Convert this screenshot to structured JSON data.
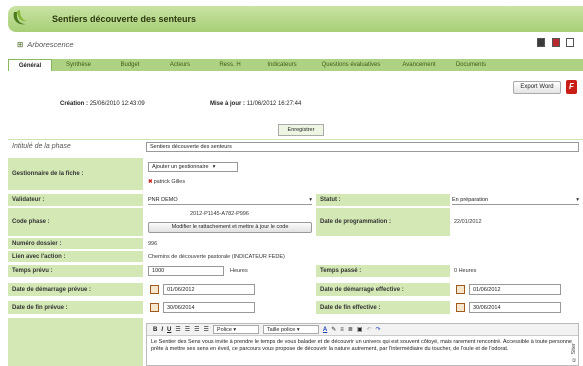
{
  "app": {
    "title": "Sentiers découverte des senteurs"
  },
  "tree": {
    "label": "Arborescence"
  },
  "tabs": [
    "Général",
    "Synthèse",
    "Budget",
    "Acteurs",
    "Ress. H",
    "Indicateurs",
    "Questions évaluatives",
    "Avancement",
    "Documents"
  ],
  "actions": {
    "export_label": "Export Word",
    "pdf_glyph": "F"
  },
  "meta": {
    "creation_label": "Création :",
    "creation_value": "25/06/2010 12:43:09",
    "update_label": "Mise à jour :",
    "update_value": "11/06/2012 16:27:44"
  },
  "save_label": "Enregistrer",
  "form": {
    "phase_label": "Intitulé de la phase",
    "phase_value": "Sentiers découverte des senteurs",
    "gestionnaire_label": "Gestionnaire de la fiche :",
    "gestionnaire_select": "Ajouter un gestionnaire",
    "gestionnaire_user": "patrick Gilles",
    "validateur_label": "Validateur :",
    "validateur_value": "PNR DEMO",
    "statut_label": "Statut :",
    "statut_value": "En préparation",
    "code_label": "Code phase :",
    "code_value": "2012-P1145-A782-P996",
    "code_button": "Modifier le rattachement et mettre à jour le code",
    "prog_label": "Date de programmation :",
    "prog_value": "22/01/2012",
    "dossier_label": "Numéro dossier :",
    "dossier_value": "996",
    "lien_label": "Lien avec l'action :",
    "lien_value": "Chemins de découverte pastorale (INDICATEUR FEDE)",
    "temps_prevu_label": "Temps prévu :",
    "temps_prevu_value": "1000",
    "temps_prevu_unit": "Heures",
    "temps_passe_label": "Temps passé :",
    "temps_passe_value": "0 Heures",
    "dem_prevue_label": "Date de démarrage prévue :",
    "dem_prevue_value": "01/06/2012",
    "dem_eff_label": "Date de démarrage effective :",
    "dem_eff_value": "01/06/2012",
    "fin_prevue_label": "Date de fin prévue :",
    "fin_prevue_value": "30/06/2014",
    "fin_eff_label": "Date de fin effective :",
    "fin_eff_value": "30/06/2014"
  },
  "editor": {
    "bold": "B",
    "italic": "I",
    "underline": "U",
    "font_select": "Police",
    "size_select": "Taille police",
    "text_color": "A",
    "text": "Le Sentier des Sens vous invite à prendre le temps de vous balader et de découvrir un univers qui est souvent côtoyé, mais rarement rencontré. Accessible à toute personne prête à mettre ses sens en éveil, ce parcours vous propose de découvrir la nature autrement, par l'intermédiaire du toucher, de l'ouïe et de l'odorat."
  },
  "watermark": "© Siter",
  "colors": {
    "accent": "#a9cf78",
    "label_bg": "#d3e8b5",
    "tab_bg": "#aed283"
  }
}
